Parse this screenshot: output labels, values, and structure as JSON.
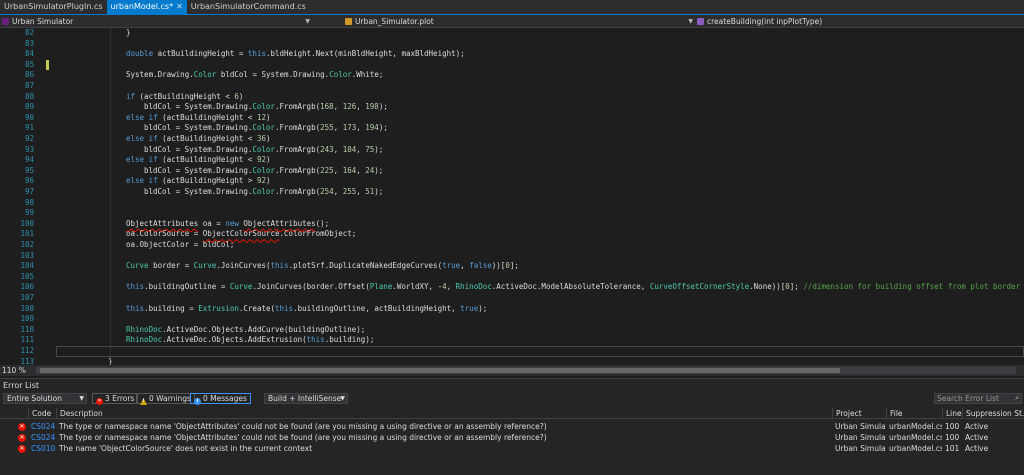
{
  "tabs": [
    {
      "label": "UrbanSimulatorPlugIn.cs",
      "active": false
    },
    {
      "label": "urbanModel.cs*",
      "active": true
    },
    {
      "label": "UrbanSimulatorCommand.cs",
      "active": false
    }
  ],
  "navbar": {
    "project": "Urban Simulator",
    "class": "Urban_Simulator.plot",
    "member": "createBuilding(int inpPlotType)"
  },
  "editor": {
    "line_numbers": [
      "82",
      "83",
      "84",
      "85",
      "86",
      "87",
      "88",
      "89",
      "90",
      "91",
      "92",
      "93",
      "94",
      "95",
      "96",
      "97",
      "98",
      "99",
      "100",
      "101",
      "102",
      "103",
      "104",
      "105",
      "106",
      "107",
      "108",
      "109",
      "110",
      "111",
      "112",
      "113",
      "114"
    ],
    "zoom": "110 %"
  },
  "code": {
    "l82": "}",
    "l84": [
      "double",
      " actBuildingHeight = ",
      "this",
      ".bldHeight.Next(minBldHeight, maxBldHeight);"
    ],
    "l86": [
      "System.Drawing.",
      "Color",
      " bldCol = System.Drawing.",
      "Color",
      ".White;"
    ],
    "l88": [
      "if",
      " (actBuildingHeight < ",
      "6",
      ")"
    ],
    "l89": [
      "bldCol = System.Drawing.",
      "Color",
      ".FromArgb(",
      "168",
      ", ",
      "126",
      ", ",
      "198",
      ");"
    ],
    "l90": [
      "else if",
      " (actBuildingHeight < ",
      "12",
      ")"
    ],
    "l91": [
      "bldCol = System.Drawing.",
      "Color",
      ".FromArgb(",
      "255",
      ", ",
      "173",
      ", ",
      "194",
      ");"
    ],
    "l92": [
      "else if",
      " (actBuildingHeight < ",
      "36",
      ")"
    ],
    "l93": [
      "bldCol = System.Drawing.",
      "Color",
      ".FromArgb(",
      "243",
      ", ",
      "104",
      ", ",
      "75",
      ");"
    ],
    "l94": [
      "else if",
      " (actBuildingHeight < ",
      "92",
      ")"
    ],
    "l95": [
      "bldCol = System.Drawing.",
      "Color",
      ".FromArgb(",
      "225",
      ", ",
      "164",
      ", ",
      "24",
      ");"
    ],
    "l96": [
      "else if",
      " (actBuildingHeight > ",
      "92",
      ")"
    ],
    "l97": [
      "bldCol = System.Drawing.",
      "Color",
      ".FromArgb(",
      "254",
      ", ",
      "255",
      ", ",
      "51",
      ");"
    ],
    "l100": [
      "ObjectAttributes",
      " oa = ",
      "new",
      " ",
      "ObjectAttributes",
      "();"
    ],
    "l101": [
      "oa.ColorSource = ",
      "ObjectColorSource",
      ".ColorFromObject;"
    ],
    "l102": [
      "oa.ObjectColor = bldCol;"
    ],
    "l104": [
      "Curve",
      " border = ",
      "Curve",
      ".JoinCurves(",
      "this",
      ".plotSrf.DuplicateNakedEdgeCurves(",
      "true",
      ", ",
      "false",
      "))[",
      "0",
      "];"
    ],
    "l106": [
      "this",
      ".buildingOutline = ",
      "Curve",
      ".JoinCurves(border.Offset(",
      "Plane",
      ".WorldXY, -",
      "4",
      ", ",
      "RhinoDoc",
      ".ActiveDoc.ModelAbsoluteTolerance, ",
      "CurveOffsetCornerStyle",
      ".None))[",
      "0",
      "]; ",
      "//dimension for building offset from plot border is list"
    ],
    "l108": [
      "this",
      ".building = ",
      "Extrusion",
      ".Create(",
      "this",
      ".buildingOutline, actBuildingHeight, ",
      "true",
      ");"
    ],
    "l110": [
      "RhinoDoc",
      ".ActiveDoc.Objects.AddCurve(buildingOutline);"
    ],
    "l111": [
      "RhinoDoc",
      ".ActiveDoc.Objects.AddExtrusion(",
      "this",
      ".building);"
    ],
    "l113": "}"
  },
  "error_list": {
    "title": "Error List",
    "scope": "Entire Solution",
    "errors_label": "3 Errors",
    "warnings_label": "0 Warnings",
    "messages_label": "0 Messages",
    "build_filter": "Build + IntelliSense",
    "search_placeholder": "Search Error List",
    "columns": [
      "Code",
      "Description",
      "Project",
      "File",
      "Line",
      "Suppression St..."
    ],
    "rows": [
      {
        "code": "CS0246",
        "description": "The type or namespace name 'ObjectAttributes' could not be found (are you missing a using directive or an assembly reference?)",
        "project": "Urban Simulator",
        "file": "urbanModel.cs",
        "line": "100",
        "state": "Active"
      },
      {
        "code": "CS0246",
        "description": "The type or namespace name 'ObjectAttributes' could not be found (are you missing a using directive or an assembly reference?)",
        "project": "Urban Simulator",
        "file": "urbanModel.cs",
        "line": "100",
        "state": "Active"
      },
      {
        "code": "CS0103",
        "description": "The name 'ObjectColorSource' does not exist in the current context",
        "project": "Urban Simulator",
        "file": "urbanModel.cs",
        "line": "101",
        "state": "Active"
      }
    ]
  },
  "colors": {
    "accent": "#007acc",
    "error": "#e51400",
    "keyword": "#569cd6",
    "type": "#4ec9b0",
    "comment": "#57a64a",
    "line_number": "#2b91af"
  }
}
